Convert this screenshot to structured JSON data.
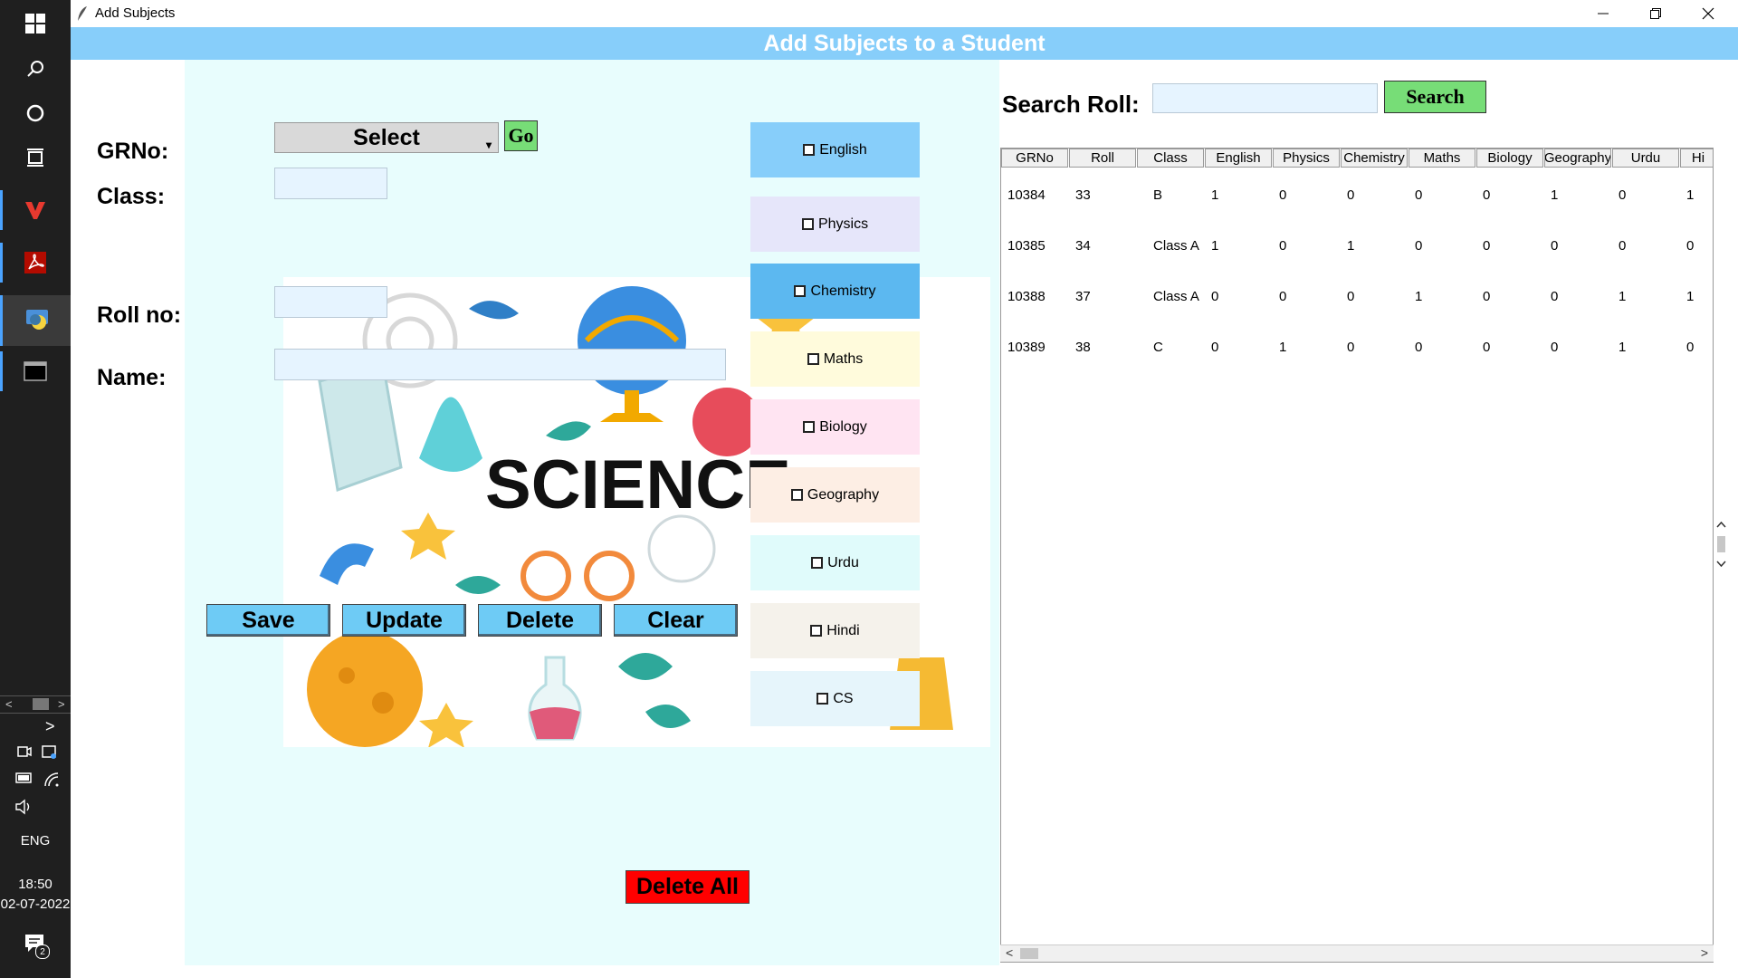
{
  "taskbar": {
    "language": "ENG",
    "time": "18:50",
    "date": "02-07-2022",
    "notification_count": "2"
  },
  "window": {
    "title": "Add Subjects",
    "header": "Add Subjects to a Student"
  },
  "form": {
    "grno_label": "GRNo:",
    "class_label": "Class:",
    "roll_label": "Roll no:",
    "name_label": "Name:",
    "combo_value": "Select",
    "go_label": "Go",
    "image_text": "SCIENCE"
  },
  "subjects": [
    {
      "label": "English",
      "color": "#87cefa"
    },
    {
      "label": "Physics",
      "color": "#e6e6fa"
    },
    {
      "label": "Chemistry",
      "color": "#5cb8f0"
    },
    {
      "label": "Maths",
      "color": "#fffbdc"
    },
    {
      "label": "Biology",
      "color": "#ffe4f2"
    },
    {
      "label": "Geography",
      "color": "#fdeee4"
    },
    {
      "label": "Urdu",
      "color": "#e0fbfb"
    },
    {
      "label": "Hindi",
      "color": "#f5f2eb"
    },
    {
      "label": "CS",
      "color": "#e6f5fb"
    }
  ],
  "buttons": {
    "save": "Save",
    "update": "Update",
    "delete": "Delete",
    "clear": "Clear",
    "delete_all": "Delete All"
  },
  "search": {
    "label": "Search Roll:",
    "button": "Search"
  },
  "table": {
    "columns": [
      "GRNo",
      "Roll",
      "Class",
      "English",
      "Physics",
      "Chemistry",
      "Maths",
      "Biology",
      "Geography",
      "Urdu",
      "Hi"
    ],
    "rows": [
      [
        "10384",
        "33",
        "B",
        "1",
        "0",
        "0",
        "0",
        "0",
        "1",
        "0",
        "1"
      ],
      [
        "10385",
        "34",
        "Class A",
        "1",
        "0",
        "1",
        "0",
        "0",
        "0",
        "0",
        "0"
      ],
      [
        "10388",
        "37",
        "Class A",
        "0",
        "0",
        "0",
        "1",
        "0",
        "0",
        "1",
        "1"
      ],
      [
        "10389",
        "38",
        "C",
        "0",
        "1",
        "0",
        "0",
        "0",
        "0",
        "1",
        "0"
      ]
    ]
  }
}
